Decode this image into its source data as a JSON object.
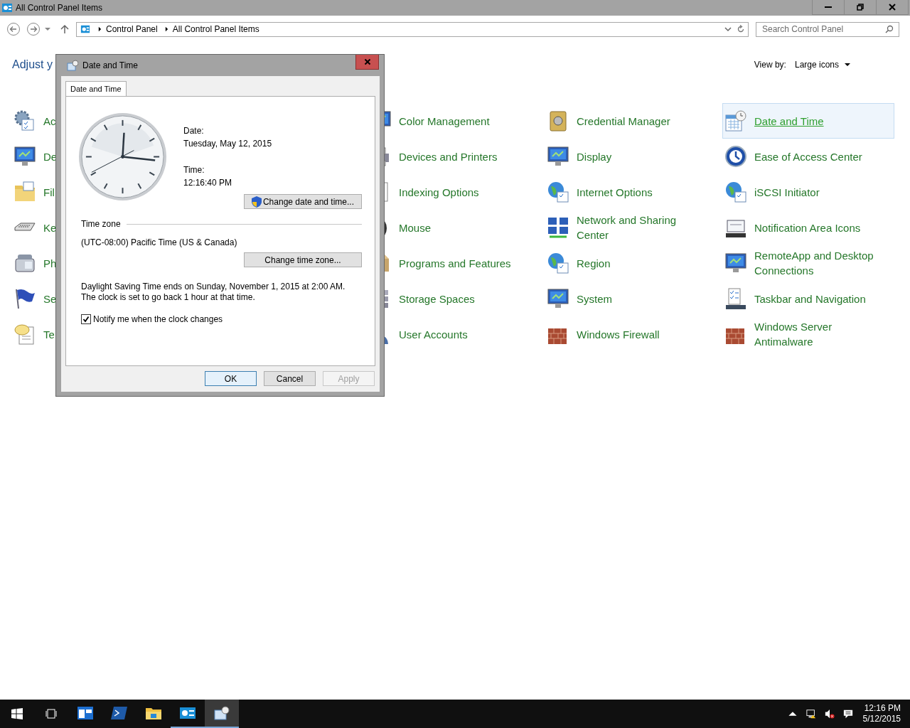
{
  "window": {
    "title": "All Control Panel Items"
  },
  "address_bar": {
    "path": [
      "Control Panel",
      "All Control Panel Items"
    ]
  },
  "search": {
    "placeholder": "Search Control Panel"
  },
  "heading": "Adjust y",
  "view_by": {
    "label": "View by:",
    "value": "Large icons"
  },
  "columns": [
    [
      {
        "label": "Ac",
        "selected": false
      },
      {
        "label": "De",
        "selected": false
      },
      {
        "label": "Fil",
        "selected": false
      },
      {
        "label": "Ke",
        "selected": false
      },
      {
        "label": "Ph",
        "selected": false
      },
      {
        "label": "Se",
        "selected": false
      },
      {
        "label": "Te",
        "selected": false
      }
    ],
    [
      {
        "label": "Color Management",
        "selected": false
      },
      {
        "label": "Devices and Printers",
        "selected": false
      },
      {
        "label": "Indexing Options",
        "selected": false
      },
      {
        "label": "Mouse",
        "selected": false
      },
      {
        "label": "Programs and Features",
        "selected": false
      },
      {
        "label": "Storage Spaces",
        "selected": false
      },
      {
        "label": "User Accounts",
        "selected": false
      }
    ],
    [
      {
        "label": "Credential Manager",
        "selected": false
      },
      {
        "label": "Display",
        "selected": false
      },
      {
        "label": "Internet Options",
        "selected": false
      },
      {
        "label": "Network and Sharing Center",
        "selected": false
      },
      {
        "label": "Region",
        "selected": false
      },
      {
        "label": "System",
        "selected": false
      },
      {
        "label": "Windows Firewall",
        "selected": false
      }
    ],
    [
      {
        "label": "Date and Time",
        "selected": true
      },
      {
        "label": "Ease of Access Center",
        "selected": false
      },
      {
        "label": "iSCSI Initiator",
        "selected": false
      },
      {
        "label": "Notification Area Icons",
        "selected": false
      },
      {
        "label": "RemoteApp and Desktop Connections",
        "selected": false
      },
      {
        "label": "Taskbar and Navigation",
        "selected": false
      },
      {
        "label": "Windows Server Antimalware",
        "selected": false
      }
    ]
  ],
  "dialog": {
    "title": "Date and Time",
    "tabs": [
      {
        "label": "Date and Time",
        "selected": true
      }
    ],
    "date_label": "Date:",
    "date": "Tuesday, May 12, 2015",
    "time_label": "Time:",
    "time": "12:16:40 PM",
    "change_datetime_button": "Change date and time...",
    "timezone_heading": "Time zone",
    "timezone": "(UTC-08:00) Pacific Time (US & Canada)",
    "change_timezone_button": "Change time zone...",
    "dst_note": "Daylight Saving Time ends on Sunday, November 1, 2015 at 2:00 AM. The clock is set to go back 1 hour at that time.",
    "notify": {
      "label": "Notify me when the clock changes",
      "checked": true
    },
    "buttons": [
      {
        "label": "OK",
        "disabled": false
      },
      {
        "label": "Cancel",
        "disabled": false
      },
      {
        "label": "Apply",
        "disabled": true
      }
    ]
  },
  "taskbar": {
    "apps": [
      {
        "running": false,
        "selected": false
      },
      {
        "running": false,
        "selected": false
      },
      {
        "running": false,
        "selected": false
      },
      {
        "running": true,
        "selected": false
      },
      {
        "running": true,
        "selected": true
      }
    ],
    "clock": {
      "time": "12:16 PM",
      "date": "5/12/2015"
    }
  }
}
